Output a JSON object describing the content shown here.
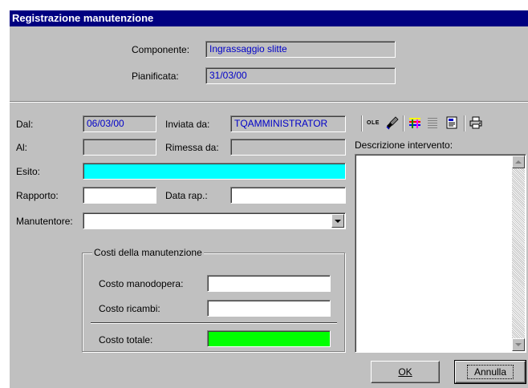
{
  "window": {
    "title": "Registrazione manutenzione"
  },
  "header": {
    "componente_label": "Componente:",
    "componente_value": "Ingrassaggio slitte",
    "pianificata_label": "Pianificata:",
    "pianificata_value": "31/03/00"
  },
  "form": {
    "dal_label": "Dal:",
    "dal_value": "06/03/00",
    "inviata_label": "Inviata da:",
    "inviata_value": "TQAMMINISTRATOR",
    "al_label": "Al:",
    "al_value": "",
    "rimessa_label": "Rimessa da:",
    "rimessa_value": "",
    "esito_label": "Esito:",
    "esito_value": "",
    "esito_color": "#00ffff",
    "rapporto_label": "Rapporto:",
    "rapporto_value": "",
    "datarap_label": "Data rap.:",
    "datarap_value": "",
    "manutentore_label": "Manutentore:",
    "manutentore_value": ""
  },
  "costs": {
    "title": "Costi della manutenzione",
    "manodopera_label": "Costo manodopera:",
    "manodopera_value": "",
    "ricambi_label": "Costo ricambi:",
    "ricambi_value": "",
    "totale_label": "Costo totale:",
    "totale_value": "",
    "totale_color": "#00ff00"
  },
  "toolbar": {
    "ole_label": "OLE",
    "icons": [
      "ole-icon",
      "paint-brush-icon",
      "color-palette-icon",
      "paragraph-icon",
      "document-insert-icon",
      "printer-icon"
    ]
  },
  "description": {
    "label": "Descrizione intervento:",
    "value": ""
  },
  "buttons": {
    "ok": "OK",
    "cancel": "Annulla"
  }
}
